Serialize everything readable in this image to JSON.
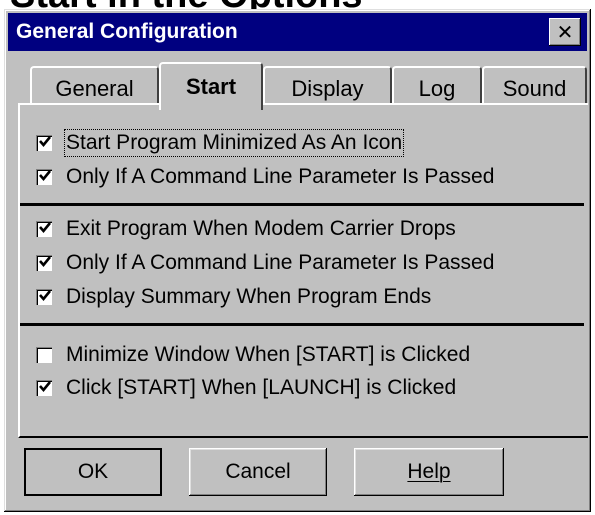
{
  "header": {
    "text": "Start in the Options"
  },
  "window": {
    "title": "General Configuration",
    "close_label": "✕"
  },
  "tabs": [
    {
      "label": "General",
      "active": false
    },
    {
      "label": "Start",
      "active": true
    },
    {
      "label": "Display",
      "active": false
    },
    {
      "label": "Log",
      "active": false
    },
    {
      "label": "Sound",
      "active": false
    }
  ],
  "groups": [
    {
      "items": [
        {
          "label": "Start Program Minimized As An Icon",
          "checked": true,
          "focused": true
        },
        {
          "label": "Only If A Command Line Parameter Is Passed",
          "checked": true
        }
      ]
    },
    {
      "items": [
        {
          "label": "Exit Program When Modem Carrier Drops",
          "checked": true
        },
        {
          "label": "Only If A Command Line Parameter Is Passed",
          "checked": true
        },
        {
          "label": "Display Summary When Program Ends",
          "checked": true
        }
      ]
    },
    {
      "items": [
        {
          "label": "Minimize Window When [START] is Clicked",
          "checked": false
        },
        {
          "label": "Click [START] When [LAUNCH] is Clicked",
          "checked": true
        }
      ]
    }
  ],
  "buttons": {
    "ok": "OK",
    "cancel": "Cancel",
    "help": "Help"
  },
  "colors": {
    "titlebar": "#000080",
    "face": "#c0c0c0"
  }
}
